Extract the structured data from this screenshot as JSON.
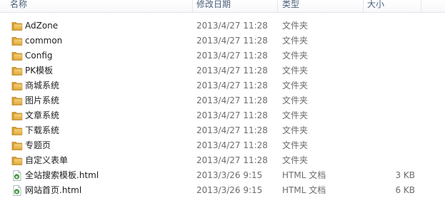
{
  "columns": {
    "name": "名称",
    "modified": "修改日期",
    "type": "类型",
    "size": "大小"
  },
  "rows": [
    {
      "name": "AdZone",
      "modified": "2013/4/27 11:28",
      "type": "文件夹",
      "size": "",
      "icon": "folder-icon"
    },
    {
      "name": "common",
      "modified": "2013/4/27 11:28",
      "type": "文件夹",
      "size": "",
      "icon": "folder-icon"
    },
    {
      "name": "Config",
      "modified": "2013/4/27 11:28",
      "type": "文件夹",
      "size": "",
      "icon": "folder-icon"
    },
    {
      "name": "PK模板",
      "modified": "2013/4/27 11:28",
      "type": "文件夹",
      "size": "",
      "icon": "folder-icon"
    },
    {
      "name": "商城系统",
      "modified": "2013/4/27 11:28",
      "type": "文件夹",
      "size": "",
      "icon": "folder-icon"
    },
    {
      "name": "图片系统",
      "modified": "2013/4/27 11:28",
      "type": "文件夹",
      "size": "",
      "icon": "folder-icon"
    },
    {
      "name": "文章系统",
      "modified": "2013/4/27 11:28",
      "type": "文件夹",
      "size": "",
      "icon": "folder-icon"
    },
    {
      "name": "下载系统",
      "modified": "2013/4/27 11:28",
      "type": "文件夹",
      "size": "",
      "icon": "folder-icon"
    },
    {
      "name": "专题页",
      "modified": "2013/4/27 11:28",
      "type": "文件夹",
      "size": "",
      "icon": "folder-icon"
    },
    {
      "name": "自定义表单",
      "modified": "2013/4/27 11:28",
      "type": "文件夹",
      "size": "",
      "icon": "folder-icon"
    },
    {
      "name": "全站搜索模板.html",
      "modified": "2013/3/26 9:15",
      "type": "HTML 文档",
      "size": "3 KB",
      "icon": "html-file-icon"
    },
    {
      "name": "网站首页.html",
      "modified": "2013/3/26 9:15",
      "type": "HTML 文档",
      "size": "6 KB",
      "icon": "html-file-icon"
    }
  ],
  "colors": {
    "folder": "#e8b64c",
    "header_text": "#4c607a",
    "html_icon": "#3a9a3a"
  }
}
